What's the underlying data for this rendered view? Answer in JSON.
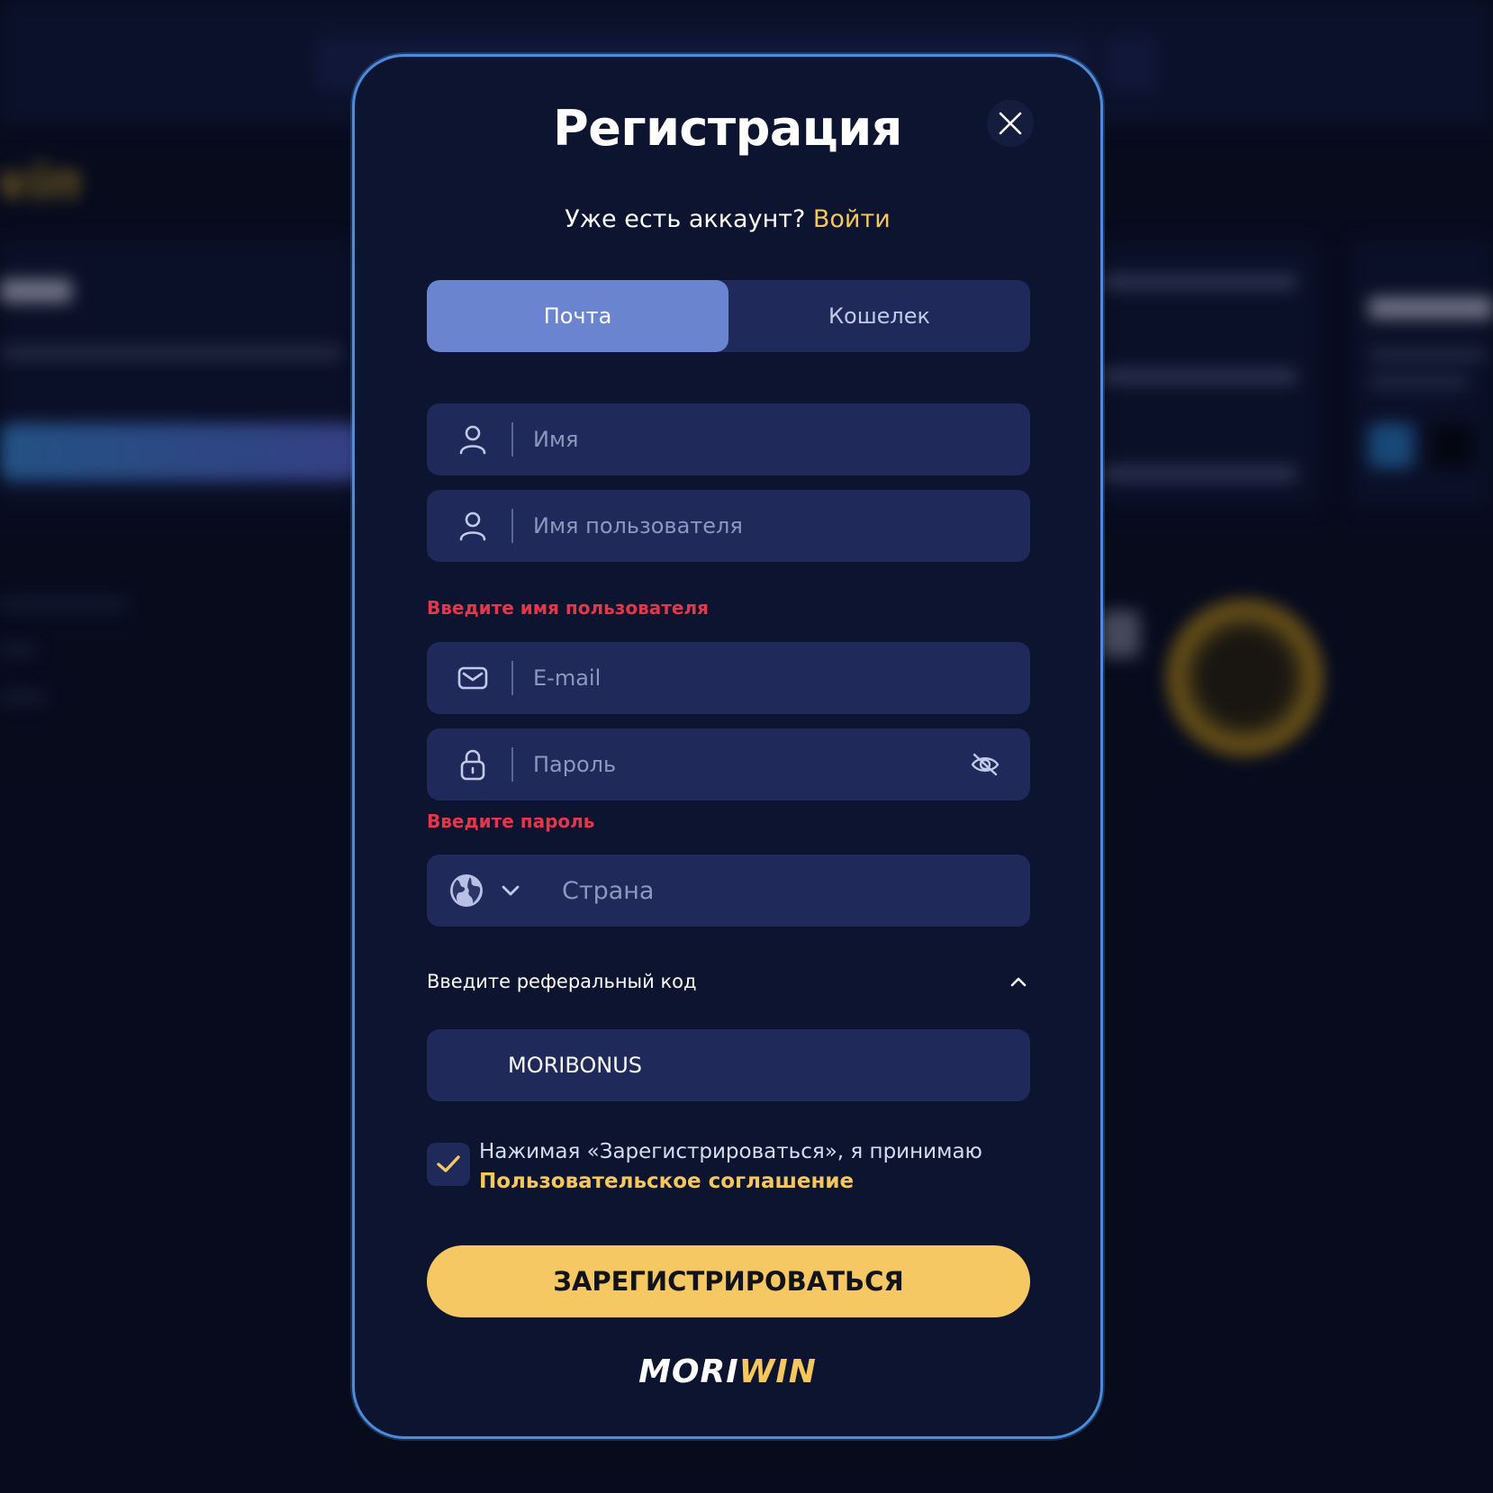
{
  "modal": {
    "title": "Регистрация",
    "login_prompt": "Уже есть аккаунт?",
    "login_link": "Войти",
    "tabs": [
      {
        "label": "Почта",
        "active": true
      },
      {
        "label": "Кошелек",
        "active": false
      }
    ],
    "fields": {
      "name_placeholder": "Имя",
      "username_placeholder": "Имя пользователя",
      "username_error": "Введите имя пользователя",
      "email_placeholder": "E-mail",
      "password_placeholder": "Пароль",
      "password_error": "Введите пароль",
      "country_placeholder": "Страна"
    },
    "referral": {
      "label": "Введите реферальный код",
      "value": "MORIBONUS"
    },
    "agreement": {
      "text": "Нажимая «Зарегистрироваться», я принимаю",
      "link": "Пользовательское соглашение",
      "checked": true
    },
    "submit_label": "ЗАРЕГИСТРИРОВАТЬСЯ",
    "brand": {
      "part1": "MORI",
      "part2": "WIN"
    }
  },
  "colors": {
    "accent_yellow": "#f5c864",
    "error_red": "#e5364b",
    "tab_active": "#6a84cf",
    "modal_border": "#4a8cdb"
  }
}
